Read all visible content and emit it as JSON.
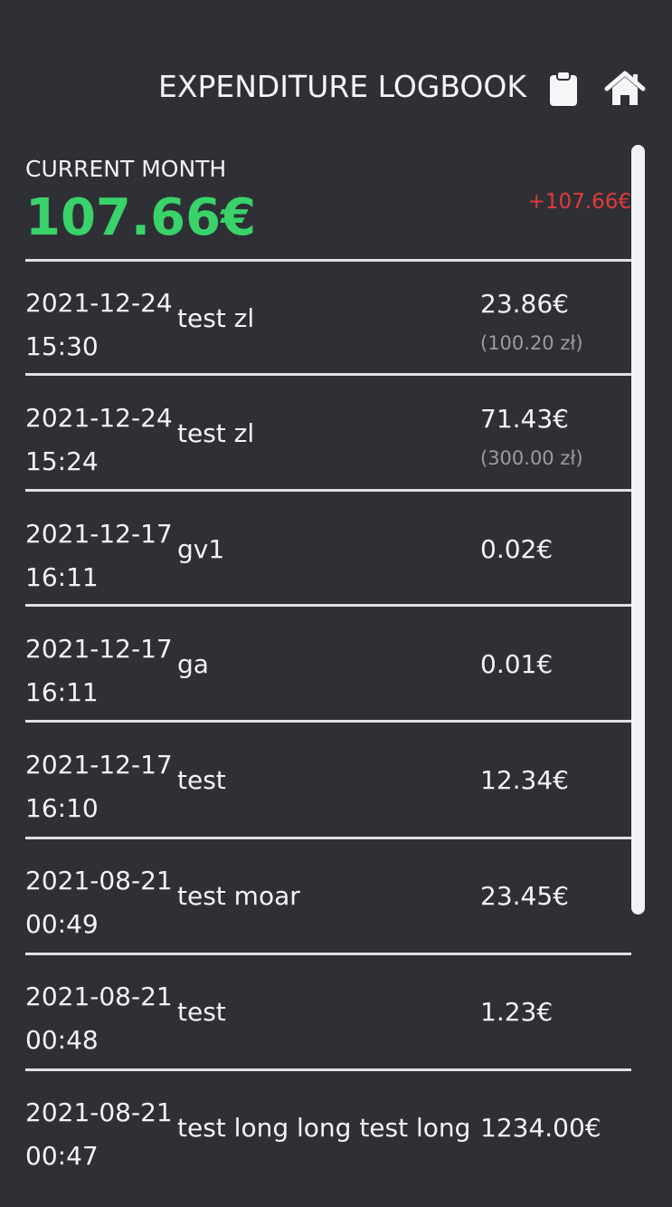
{
  "header": {
    "title": "EXPENDITURE LOGBOOK",
    "icons": [
      "clipboard-icon",
      "home-icon"
    ]
  },
  "summary": {
    "label": "CURRENT MONTH",
    "total": "107.66€",
    "diff": "+107.66€",
    "total_color": "#39d36a",
    "diff_color": "#e03a3a"
  },
  "entries": [
    {
      "date": "2021-12-24",
      "time": "15:30",
      "description": "test zl",
      "amount": "23.86€",
      "original": "(100.20 zł)"
    },
    {
      "date": "2021-12-24",
      "time": "15:24",
      "description": "test zl",
      "amount": "71.43€",
      "original": "(300.00 zł)"
    },
    {
      "date": "2021-12-17",
      "time": "16:11",
      "description": "gv1",
      "amount": "0.02€",
      "original": ""
    },
    {
      "date": "2021-12-17",
      "time": "16:11",
      "description": "ga",
      "amount": "0.01€",
      "original": ""
    },
    {
      "date": "2021-12-17",
      "time": "16:10",
      "description": "test",
      "amount": "12.34€",
      "original": ""
    },
    {
      "date": "2021-08-21",
      "time": "00:49",
      "description": "test moar",
      "amount": "23.45€",
      "original": ""
    },
    {
      "date": "2021-08-21",
      "time": "00:48",
      "description": "test",
      "amount": "1.23€",
      "original": ""
    },
    {
      "date": "2021-08-21",
      "time": "00:47",
      "description": "test long long test long",
      "amount": "1234.00€",
      "original": ""
    }
  ]
}
